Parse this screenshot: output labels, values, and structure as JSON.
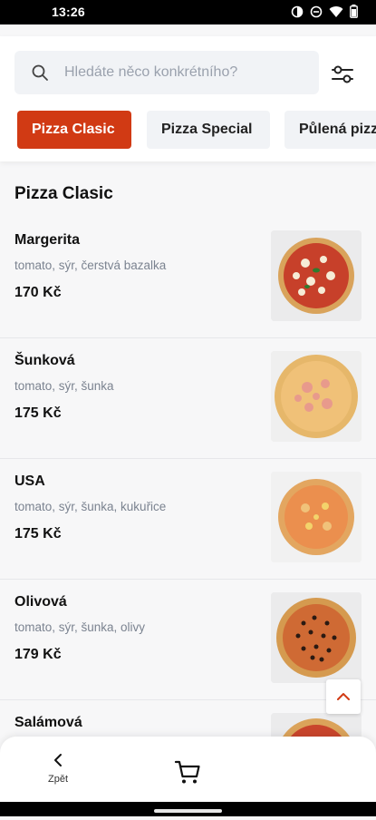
{
  "status_bar": {
    "time": "13:26"
  },
  "search": {
    "placeholder": "Hledáte něco konkrétního?"
  },
  "tabs": [
    {
      "label": "Pizza Clasic",
      "active": true
    },
    {
      "label": "Pizza Special",
      "active": false
    },
    {
      "label": "Půlená pizza",
      "active": false
    }
  ],
  "section_title": "Pizza Clasic",
  "menu_items": [
    {
      "name": "Margerita",
      "description": "tomato, sýr, čerstvá bazalka",
      "price": "170 Kč",
      "image": "margherita-pizza"
    },
    {
      "name": "Šunková",
      "description": "tomato, sýr, šunka",
      "price": "175 Kč",
      "image": "ham-pizza"
    },
    {
      "name": "USA",
      "description": "tomato, sýr, šunka, kukuřice",
      "price": "175 Kč",
      "image": "usa-pizza"
    },
    {
      "name": "Olivová",
      "description": "tomato, sýr, šunka, olivy",
      "price": "179 Kč",
      "image": "olive-pizza"
    },
    {
      "name": "Salámová",
      "description": "",
      "price": "",
      "image": "salami-pizza"
    }
  ],
  "bottom_nav": {
    "back_label": "Zpět"
  },
  "colors": {
    "accent": "#d13a14",
    "tab_inactive": "#f1f3f6",
    "text_muted": "#7b8390"
  }
}
